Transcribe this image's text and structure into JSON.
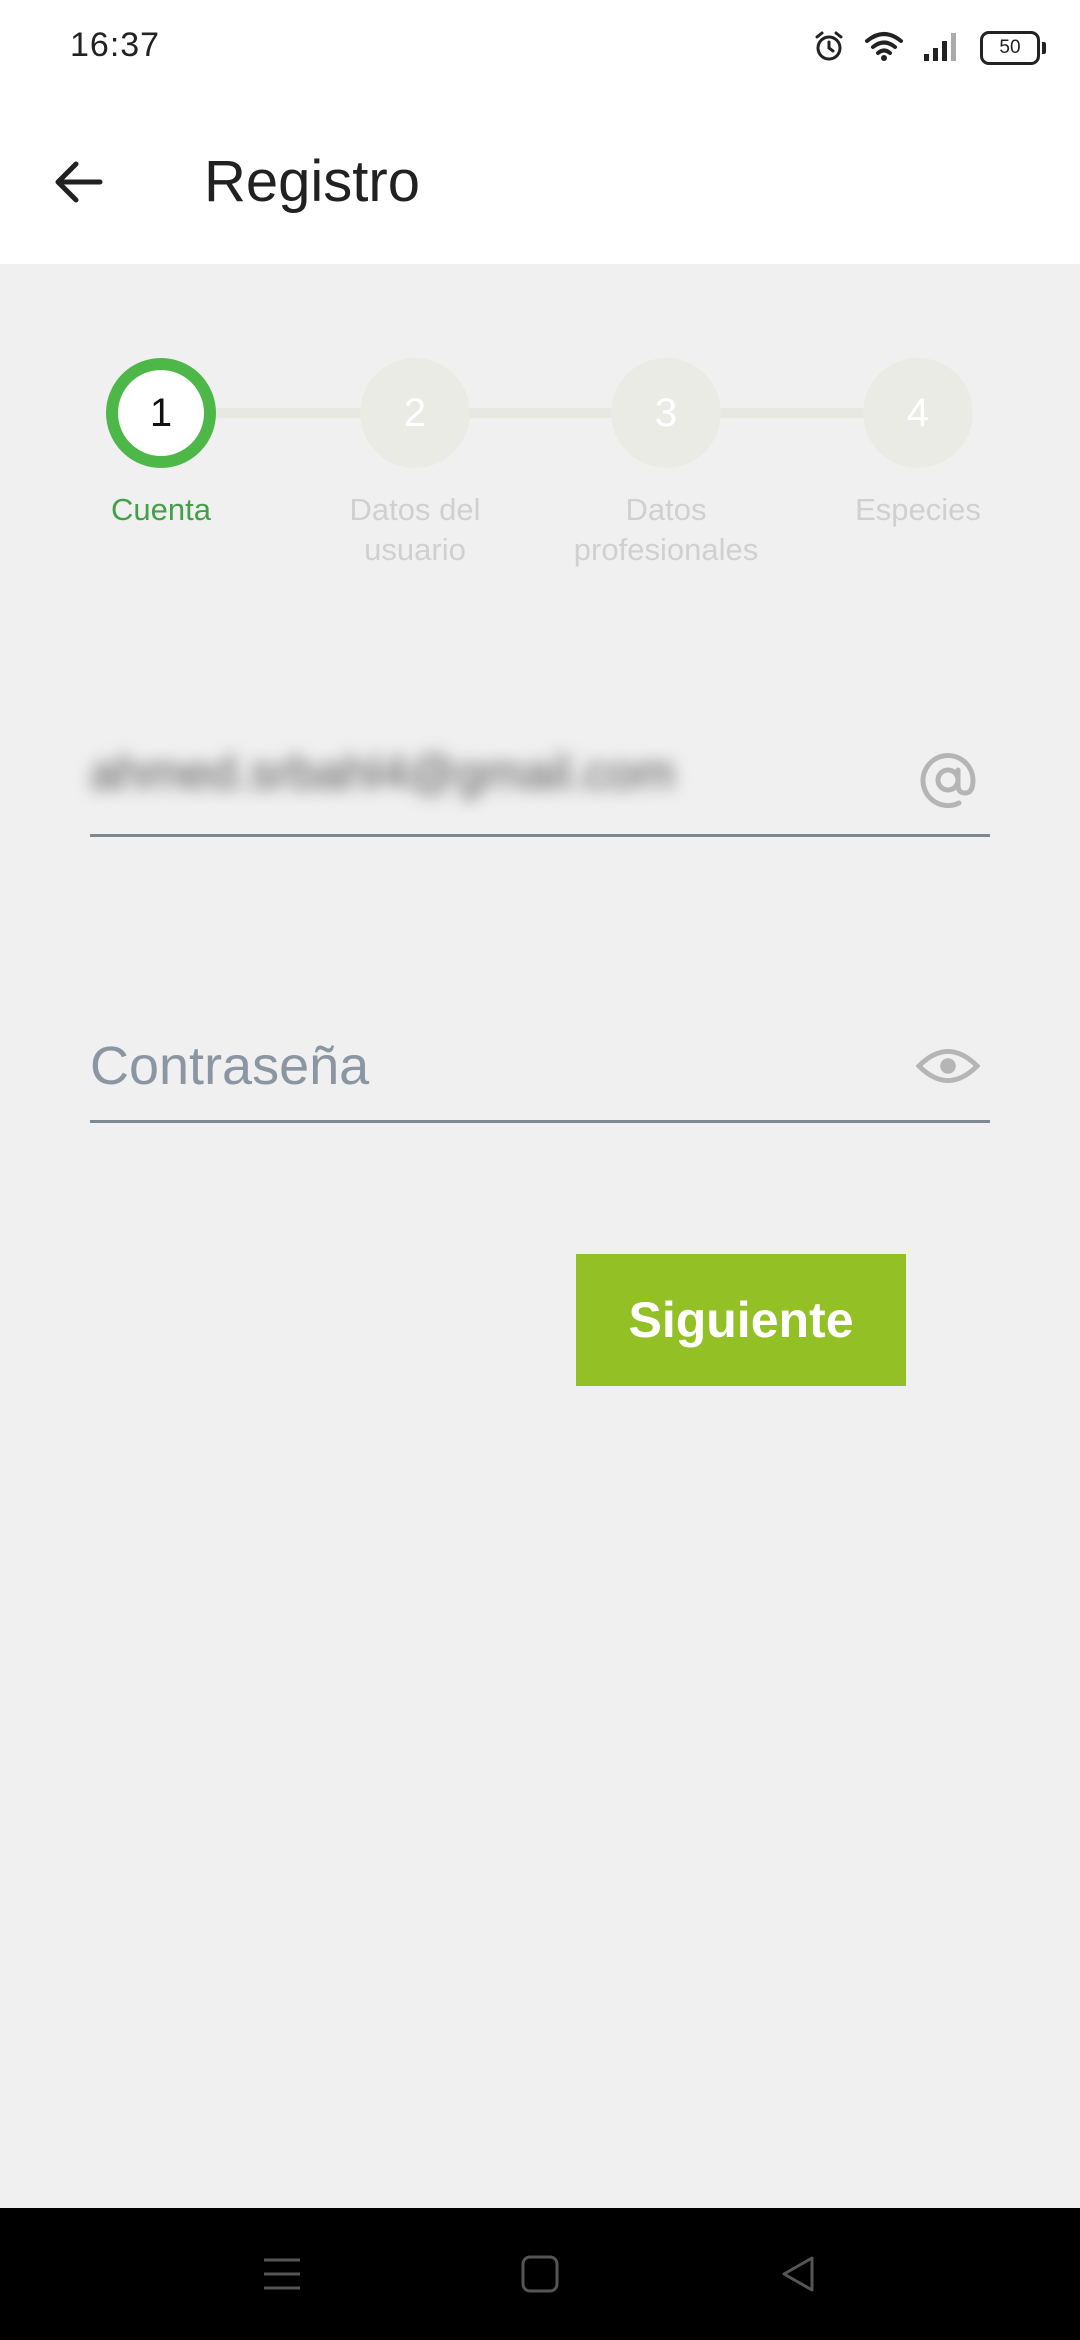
{
  "status_bar": {
    "time": "16:37",
    "battery": "50",
    "icons": [
      "alarm-icon",
      "wifi-icon",
      "signal-icon",
      "battery-icon"
    ]
  },
  "app_bar": {
    "title": "Registro",
    "back_icon": "arrow-back-icon"
  },
  "stepper": {
    "steps": [
      {
        "number": "1",
        "label_line1": "Cuenta",
        "label_line2": "",
        "active": true
      },
      {
        "number": "2",
        "label_line1": "Datos del",
        "label_line2": "usuario",
        "active": false
      },
      {
        "number": "3",
        "label_line1": "Datos",
        "label_line2": "profesionales",
        "active": false
      },
      {
        "number": "4",
        "label_line1": "Especies",
        "label_line2": "",
        "active": false
      }
    ]
  },
  "form": {
    "email": {
      "value": "ahmed.srbahl4@gmail.com",
      "icon": "at-icon"
    },
    "password": {
      "placeholder": "Contraseña",
      "icon": "eye-icon"
    },
    "next_label": "Siguiente"
  },
  "nav_bar": {
    "icons": [
      "menu-icon",
      "home-icon",
      "back-triangle-icon"
    ]
  },
  "colors": {
    "accent_green": "#4db848",
    "button_green": "#93c125",
    "background": "#f0f0f0"
  }
}
